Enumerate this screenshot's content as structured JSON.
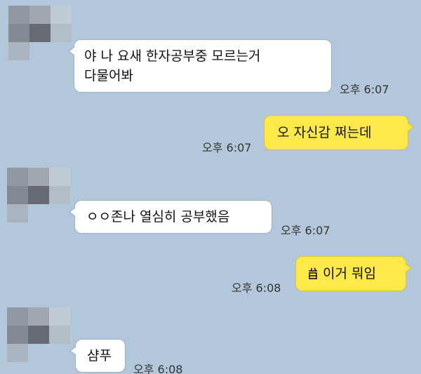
{
  "messages": [
    {
      "direction": "incoming",
      "lines": [
        "야 나 요새 한자공부중 모르는거",
        "다물어봐"
      ],
      "time": "오후 6:07"
    },
    {
      "direction": "outgoing",
      "lines": [
        "오 자신감 쩌는데"
      ],
      "time": "오후 6:07"
    },
    {
      "direction": "incoming",
      "lines": [
        "ㅇㅇ존나 열심히 공부했음"
      ],
      "time": "오후 6:07"
    },
    {
      "direction": "outgoing",
      "icon": "hanja-character-icon",
      "lines": [
        "이거 뭐임"
      ],
      "time": "오후 6:08"
    },
    {
      "direction": "incoming",
      "lines": [
        "샴푸"
      ],
      "time": "오후 6:08"
    }
  ],
  "colors": {
    "background": "#b2c7d9",
    "incoming_bubble": "#ffffff",
    "outgoing_bubble": "#fee94a"
  }
}
